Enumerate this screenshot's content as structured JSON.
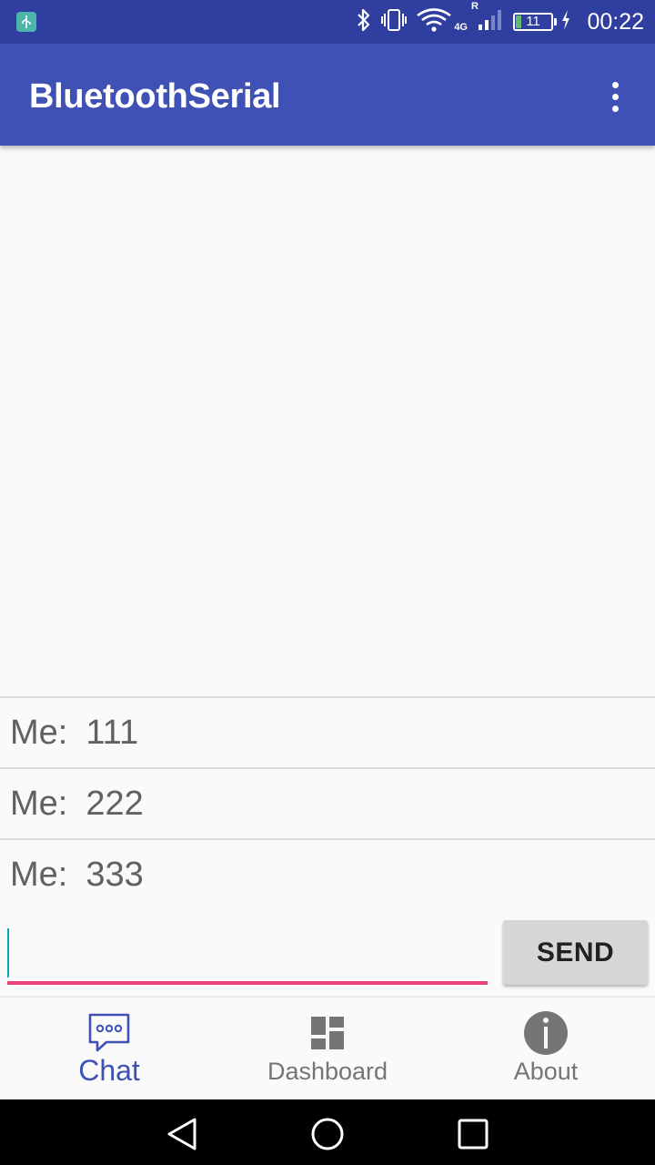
{
  "status_bar": {
    "time": "00:22",
    "battery_level": "11",
    "network_type": "4G",
    "roaming_label": "R",
    "icons": [
      "usb-debug-icon",
      "bluetooth-icon",
      "vibrate-icon",
      "wifi-icon",
      "signal-icon",
      "battery-icon",
      "charging-icon"
    ]
  },
  "app_bar": {
    "title": "BluetoothSerial",
    "overflow_icon": "more-vert-icon"
  },
  "chat": {
    "messages": [
      {
        "sender": "Me:",
        "text": "111"
      },
      {
        "sender": "Me:",
        "text": "222"
      },
      {
        "sender": "Me:",
        "text": "333"
      }
    ],
    "input": {
      "value": "",
      "placeholder": ""
    },
    "send_label": "SEND"
  },
  "bottom_nav": {
    "items": [
      {
        "label": "Chat",
        "icon": "chat-bubble-icon",
        "active": true
      },
      {
        "label": "Dashboard",
        "icon": "dashboard-icon",
        "active": false
      },
      {
        "label": "About",
        "icon": "info-icon",
        "active": false
      }
    ]
  },
  "colors": {
    "primary": "#3f51b5",
    "primary_dark": "#303f9f",
    "accent": "#ec407a"
  }
}
